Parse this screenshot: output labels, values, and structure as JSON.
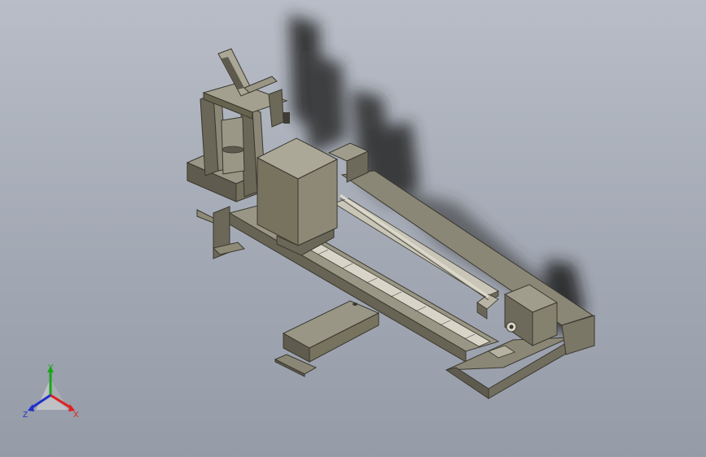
{
  "viewport": {
    "background_top": "#b8bdc7",
    "background_bottom": "#959ba7"
  },
  "model": {
    "part_color": "#7f7b6a",
    "shadow_color": "#1e1e1e"
  },
  "triad": {
    "x_label": "X",
    "y_label": "Y",
    "z_label": "Z",
    "x_color": "#e02020",
    "y_color": "#1aa51a",
    "z_color": "#2030c8"
  }
}
